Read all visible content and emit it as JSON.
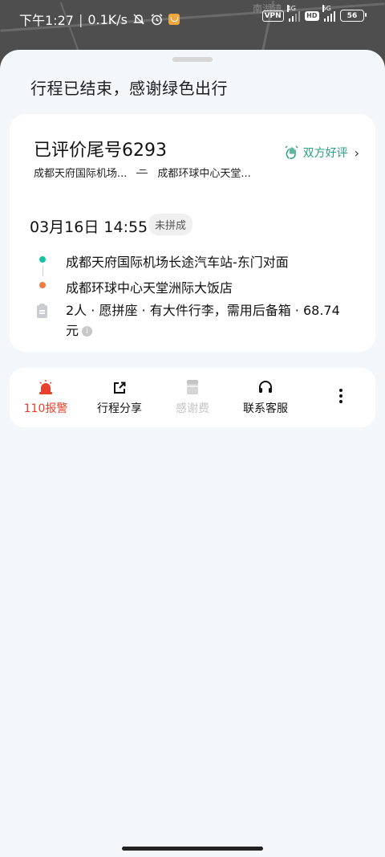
{
  "status_bar": {
    "time": "下午1:27",
    "network_speed": "0.1K/s",
    "vpn": "VPN",
    "net_4g": "4G",
    "hd": "HD",
    "net_5g": "5G",
    "battery": "56"
  },
  "map": {
    "label": "南湖镇"
  },
  "sheet": {
    "title": "行程已结束，感谢绿色出行"
  },
  "trip_card": {
    "evaluated": "已评价尾号6293",
    "review_badge": "双方好评",
    "route_from_short": "成都天府国际机场...",
    "route_to_short": "成都环球中心天堂...",
    "date": "03月16日 14:55",
    "status_tag": "未拼成",
    "start": "成都天府国际机场长途汽车站-东门对面",
    "end": "成都环球中心天堂洲际大饭店",
    "details": "2人 · 愿拼座 · 有大件行李，需用后备箱 · 68.74元",
    "info_icon": "i",
    "colors": {
      "start_dot": "#16c2a3",
      "end_dot": "#f07b3f",
      "accent": "#28a07f"
    }
  },
  "actions": [
    {
      "label": "110报警",
      "icon": "alarm-icon",
      "color": "#e8402c"
    },
    {
      "label": "行程分享",
      "icon": "share-icon",
      "color": "#111111"
    },
    {
      "label": "感谢费",
      "icon": "tip-icon",
      "color": "#c4c4c4"
    },
    {
      "label": "联系客服",
      "icon": "headset-icon",
      "color": "#111111"
    }
  ]
}
